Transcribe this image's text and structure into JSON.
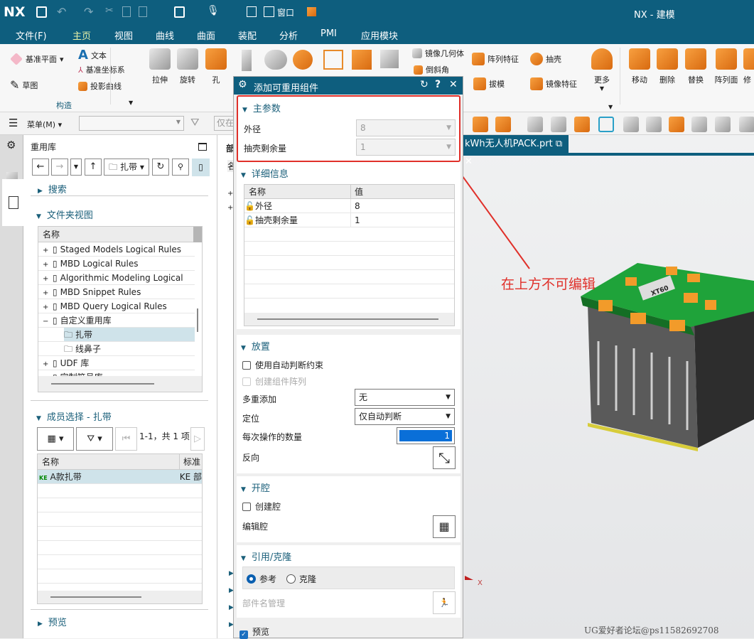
{
  "app": {
    "logo": "NX",
    "title": "NX - 建模",
    "window_menu": "窗口"
  },
  "menu": [
    "文件(F)",
    "主页",
    "视图",
    "曲线",
    "曲面",
    "装配",
    "分析",
    "PMI",
    "应用模块"
  ],
  "ribbon": {
    "construct": {
      "datum_plane": "基准平面",
      "text": "文本",
      "datum_csys": "基准坐标系",
      "sketch": "草图",
      "project_curve": "投影曲线",
      "group_label": "构造"
    },
    "large": [
      "拉伸",
      "旋转",
      "孔"
    ],
    "small": [
      "镜像几何体",
      "倒斜角",
      "阵列特征",
      "抽壳",
      "拔模",
      "镜像特征"
    ],
    "more": "更多",
    "sync": [
      "移动",
      "删除",
      "替换",
      "阵列面",
      "修"
    ]
  },
  "toolbar": {
    "menu": "菜单(M)",
    "filter_placeholder": "仅在"
  },
  "reuse_library": {
    "title": "重用库",
    "folder": "扎带",
    "search": "搜索",
    "folder_view": "文件夹视图",
    "tree_header": "名称",
    "tree": [
      {
        "label": "Staged Models Logical Rules",
        "exp": "+",
        "lvl": 0
      },
      {
        "label": "MBD Logical Rules",
        "exp": "+",
        "lvl": 0
      },
      {
        "label": "Algorithmic Modeling Logical",
        "exp": "+",
        "lvl": 0
      },
      {
        "label": "MBD Snippet Rules",
        "exp": "+",
        "lvl": 0
      },
      {
        "label": "MBD Query Logical Rules",
        "exp": "+",
        "lvl": 0
      },
      {
        "label": "自定义重用库",
        "exp": "−",
        "lvl": 0
      },
      {
        "label": "扎带",
        "exp": "",
        "lvl": 1,
        "selected": true
      },
      {
        "label": "线鼻子",
        "exp": "",
        "lvl": 1
      },
      {
        "label": "UDF 库",
        "exp": "+",
        "lvl": 0
      },
      {
        "label": "定制符号库",
        "exp": "−",
        "lvl": 0
      }
    ],
    "member_select": "成员选择 - 扎带",
    "pager": "1-1，共 1 项",
    "member_headers": [
      "名称",
      "标准"
    ],
    "members": [
      {
        "name": "A款扎带",
        "std": "KE 部"
      }
    ],
    "preview": "预览"
  },
  "middle_panel": {
    "title": "部",
    "col": "名"
  },
  "dialog": {
    "title": "添加可重用组件",
    "main_params": {
      "title": "主参数",
      "outer_dia_label": "外径",
      "outer_dia": "8",
      "shell_label": "抽壳剩余量",
      "shell": "1"
    },
    "details": {
      "title": "详细信息",
      "headers": [
        "名称",
        "值"
      ],
      "rows": [
        {
          "name": "外径",
          "value": "8"
        },
        {
          "name": "抽壳剩余量",
          "value": "1"
        }
      ]
    },
    "placement": {
      "title": "放置",
      "auto_constraint": "使用自动判断约束",
      "create_array": "创建组件阵列",
      "multi_add_label": "多重添加",
      "multi_add": "无",
      "position_label": "定位",
      "position": "仅自动判断",
      "count_label": "每次操作的数量",
      "count": "1",
      "reverse_label": "反向"
    },
    "cavity": {
      "title": "开腔",
      "create": "创建腔",
      "edit": "编辑腔"
    },
    "ref_clone": {
      "title": "引用/克隆",
      "reference": "参考",
      "clone": "克隆",
      "selected": "参考",
      "name_mgmt": "部件名管理"
    },
    "preview": "预览",
    "preview_checked": true
  },
  "graphics": {
    "tab": "kWh无人机PACK.prt",
    "annotation": "在上方不可编辑",
    "model_label": "XT60",
    "axis": "X",
    "watermark": "UG爱好者论坛@ps11582692708"
  },
  "colors": {
    "title_bar": "#0e5e7e",
    "accent": "#1a5f7a",
    "annotation": "#e0302a",
    "selection": "#cfe3ea"
  }
}
